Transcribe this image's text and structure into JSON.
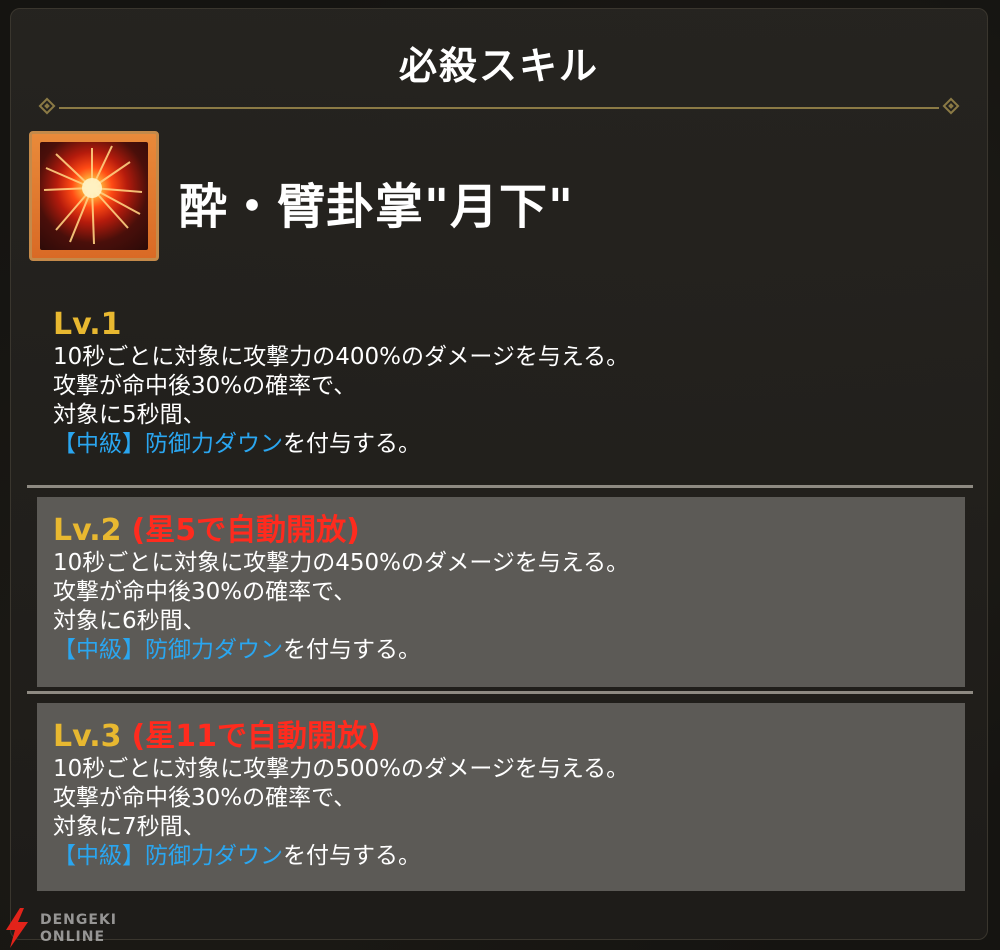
{
  "panel": {
    "title": "必殺スキル"
  },
  "skill": {
    "name": "酔・臂卦掌\"月下\"",
    "icon": "burst-explosion-icon"
  },
  "levels": [
    {
      "label": "Lv.1",
      "unlock": "",
      "lines": [
        "10秒ごとに対象に攻撃力の400%のダメージを与える。",
        "攻撃が命中後30%の確率で、",
        "対象に5秒間、"
      ],
      "debuff": "【中級】防御力ダウン",
      "debuff_suffix": "を付与する。"
    },
    {
      "label": "Lv.2",
      "unlock": "(星5で自動開放)",
      "lines": [
        "10秒ごとに対象に攻撃力の450%のダメージを与える。",
        "攻撃が命中後30%の確率で、",
        "対象に6秒間、"
      ],
      "debuff": "【中級】防御力ダウン",
      "debuff_suffix": "を付与する。"
    },
    {
      "label": "Lv.3",
      "unlock": "(星11で自動開放)",
      "lines": [
        "10秒ごとに対象に攻撃力の500%のダメージを与える。",
        "攻撃が命中後30%の確率で、",
        "対象に7秒間、"
      ],
      "debuff": "【中級】防御力ダウン",
      "debuff_suffix": "を付与する。"
    }
  ],
  "colors": {
    "level_label": "#e8b830",
    "unlock_text": "#ff2b1e",
    "debuff_text": "#2aa6f0",
    "divider_gold": "#8b7a45"
  },
  "watermark": {
    "line1": "DENGEKI",
    "line2": "ONLINE"
  }
}
